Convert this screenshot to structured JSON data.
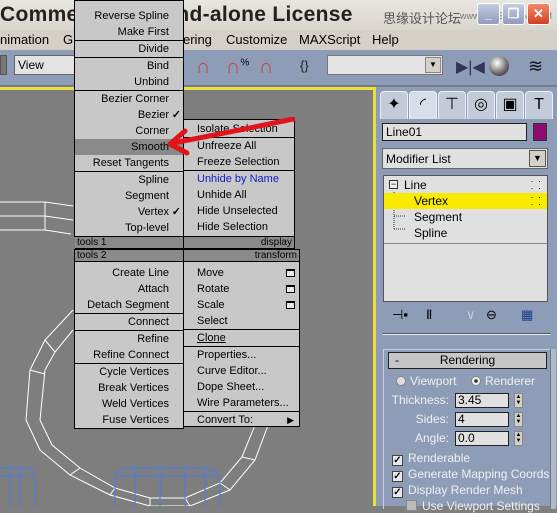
{
  "window": {
    "title": "Commercial - Stand-alone License",
    "watermark": "思缘设计论坛",
    "watermark_url": "www.MISSYUAN.COM",
    "controls": [
      "minimize",
      "restore",
      "close"
    ]
  },
  "menubar": [
    "nimation",
    "Gr",
    "ering",
    "Customize",
    "MAXScript",
    "Help"
  ],
  "toolbar": {
    "view_select": "View",
    "named_selection": "",
    "icons": [
      "angle-snap-icon",
      "percent-snap-icon",
      "spinner-snap-icon",
      "edit-named-selection-icon",
      "mirror-icon",
      "material-editor-icon",
      "layers-icon"
    ]
  },
  "quad_menu": {
    "tools1": {
      "header": "tools 1",
      "items": [
        {
          "label": "Reverse Spline"
        },
        {
          "label": "Make First"
        },
        {
          "label": "Divide"
        },
        {
          "label": "Bind"
        },
        {
          "label": "Unbind"
        },
        {
          "label": "Bezier Corner"
        },
        {
          "label": "Bezier",
          "checked": true
        },
        {
          "label": "Corner"
        },
        {
          "label": "Smooth",
          "highlighted": true
        },
        {
          "label": "Reset Tangents"
        },
        {
          "label": "Spline"
        },
        {
          "label": "Segment"
        },
        {
          "label": "Vertex",
          "checked": true
        },
        {
          "label": "Top-level"
        }
      ]
    },
    "display": {
      "header": "display",
      "items": [
        {
          "label": "Isolate Selection"
        },
        {
          "label": "Unfreeze All"
        },
        {
          "label": "Freeze Selection"
        },
        {
          "label": "Unhide by Name",
          "color": "#1020c8"
        },
        {
          "label": "Unhide All"
        },
        {
          "label": "Hide Unselected"
        },
        {
          "label": "Hide Selection"
        }
      ]
    },
    "tools2": {
      "header": "tools 2",
      "items": [
        {
          "label": "Create Line"
        },
        {
          "label": "Attach"
        },
        {
          "label": "Detach Segment"
        },
        {
          "label": "Connect"
        },
        {
          "label": "Refine"
        },
        {
          "label": "Refine Connect"
        },
        {
          "label": "Cycle Vertices"
        },
        {
          "label": "Break Vertices"
        },
        {
          "label": "Weld Vertices"
        },
        {
          "label": "Fuse Vertices"
        }
      ]
    },
    "transform": {
      "header": "transform",
      "items": [
        {
          "label": "Move",
          "has_settings": true
        },
        {
          "label": "Rotate",
          "has_settings": true
        },
        {
          "label": "Scale",
          "has_settings": true
        },
        {
          "label": "Select"
        },
        {
          "label": "Clone"
        },
        {
          "label": "Properties..."
        },
        {
          "label": "Curve Editor..."
        },
        {
          "label": "Dope Sheet..."
        },
        {
          "label": "Wire Parameters..."
        },
        {
          "label": "Convert To:",
          "submenu": true
        }
      ]
    }
  },
  "command_panel": {
    "tabs": [
      "create",
      "modify",
      "hierarchy",
      "motion",
      "display",
      "utilities"
    ],
    "object_name": "Line01",
    "object_color": "#8c0a6e",
    "modifier_list": "Modifier List",
    "stack": [
      {
        "label": "Line",
        "level": 0,
        "expanded": true
      },
      {
        "label": "Vertex",
        "level": 1,
        "selected": true
      },
      {
        "label": "Segment",
        "level": 1
      },
      {
        "label": "Spline",
        "level": 1
      }
    ],
    "stack_tools": [
      "pin-stack",
      "show-end-result",
      "make-unique",
      "remove-modifier",
      "configure-modifier-sets"
    ],
    "rendering": {
      "title": "Rendering",
      "collapse_symbol": "-",
      "viewport_label": "Viewport",
      "renderer_label": "Renderer",
      "mode": "Renderer",
      "thickness_label": "Thickness:",
      "thickness": "3.45",
      "sides_label": "Sides:",
      "sides": "4",
      "angle_label": "Angle:",
      "angle": "0.0",
      "renderable_label": "Renderable",
      "renderable": true,
      "mapping_label": "Generate Mapping Coords.",
      "mapping": true,
      "display_mesh_label": "Display Render Mesh",
      "display_mesh": true,
      "use_viewport_label": "Use Viewport Settings",
      "use_viewport": false
    }
  }
}
